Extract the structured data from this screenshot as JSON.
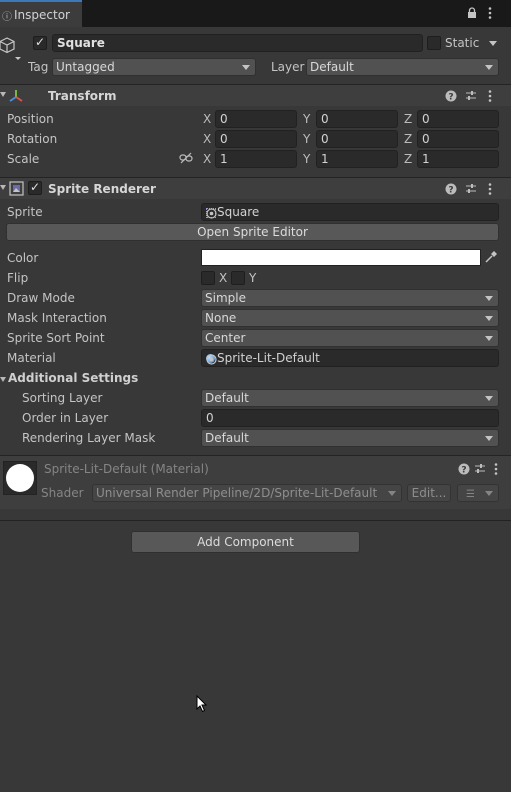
{
  "tab": {
    "title": "Inspector"
  },
  "object": {
    "name": "Square",
    "static_label": "Static",
    "tag_label": "Tag",
    "tag_value": "Untagged",
    "layer_label": "Layer",
    "layer_value": "Default"
  },
  "transform": {
    "title": "Transform",
    "position": {
      "label": "Position",
      "x": "0",
      "y": "0",
      "z": "0"
    },
    "rotation": {
      "label": "Rotation",
      "x": "0",
      "y": "0",
      "z": "0"
    },
    "scale": {
      "label": "Scale",
      "x": "1",
      "y": "1",
      "z": "1"
    },
    "axis_x": "X",
    "axis_y": "Y",
    "axis_z": "Z"
  },
  "sprite_renderer": {
    "title": "Sprite Renderer",
    "sprite_label": "Sprite",
    "sprite_value": "Square",
    "open_editor_label": "Open Sprite Editor",
    "color_label": "Color",
    "color_value": "#ffffff",
    "flip_label": "Flip",
    "flip_x": "X",
    "flip_y": "Y",
    "draw_mode_label": "Draw Mode",
    "draw_mode_value": "Simple",
    "mask_label": "Mask Interaction",
    "mask_value": "None",
    "sort_point_label": "Sprite Sort Point",
    "sort_point_value": "Center",
    "material_label": "Material",
    "material_value": "Sprite-Lit-Default",
    "additional_label": "Additional Settings",
    "sorting_layer_label": "Sorting Layer",
    "sorting_layer_value": "Default",
    "order_label": "Order in Layer",
    "order_value": "0",
    "render_mask_label": "Rendering Layer Mask",
    "render_mask_value": "Default"
  },
  "material": {
    "title": "Sprite-Lit-Default (Material)",
    "shader_label": "Shader",
    "shader_value": "Universal Render Pipeline/2D/Sprite-Lit-Default",
    "edit_label": "Edit..."
  },
  "add_component_label": "Add Component",
  "icons": {
    "info": "info-icon",
    "lock": "lock-icon",
    "menu": "kebab-menu-icon",
    "help": "help-icon",
    "presets": "presets-icon",
    "cube": "cube-icon",
    "transform": "transform-axes-icon",
    "sprite_renderer": "sprite-renderer-icon",
    "link": "constrain-proportions-icon",
    "target": "object-picker-icon",
    "eyedropper": "eyedropper-icon"
  },
  "colors": {
    "background": "#383838",
    "header": "#3e3e3e",
    "field": "#2a2a2a",
    "accent": "#3a79bb"
  }
}
